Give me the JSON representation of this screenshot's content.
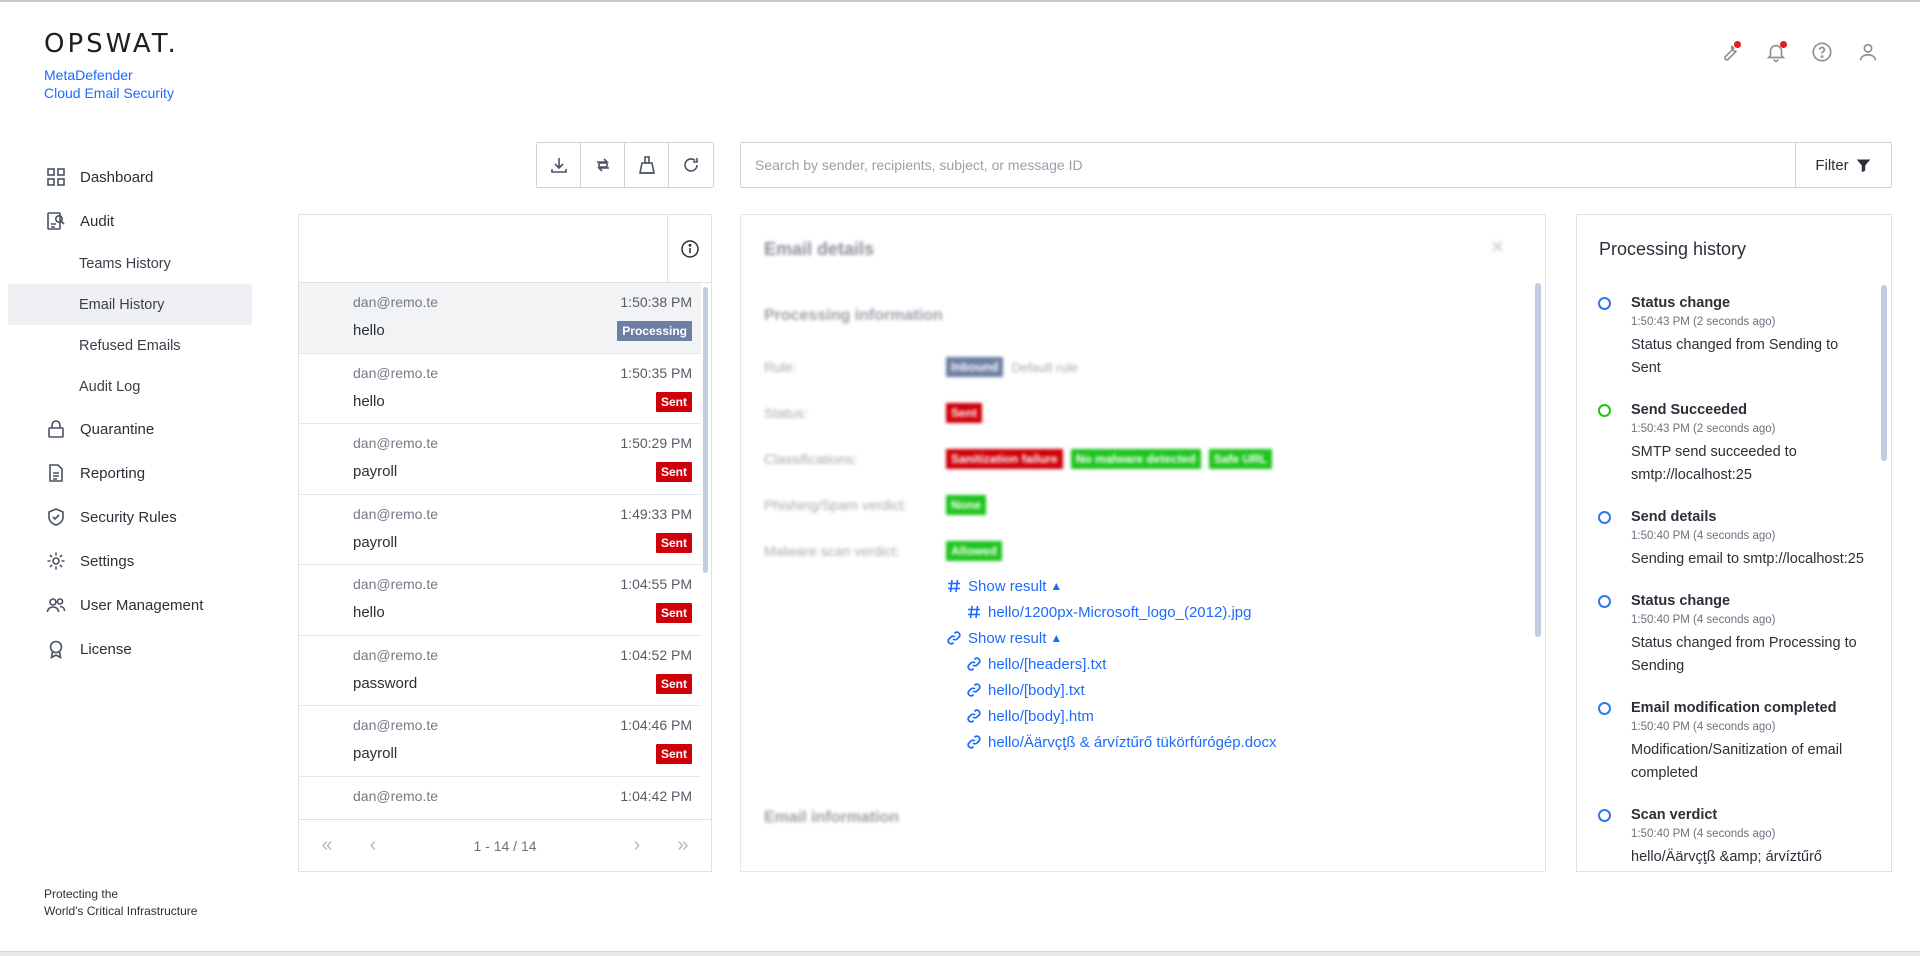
{
  "brand": {
    "logo": "OPSWAT.",
    "product_line1": "MetaDefender",
    "product_line2": "Cloud Email Security"
  },
  "footer": {
    "line1": "Protecting the",
    "line2": "World's Critical Infrastructure"
  },
  "nav": {
    "dashboard": "Dashboard",
    "audit": "Audit",
    "teams_history": "Teams History",
    "email_history": "Email History",
    "refused_emails": "Refused Emails",
    "audit_log": "Audit Log",
    "quarantine": "Quarantine",
    "reporting": "Reporting",
    "security_rules": "Security Rules",
    "settings": "Settings",
    "user_management": "User Management",
    "license": "License"
  },
  "search": {
    "placeholder": "Search by sender, recipients, subject, or message ID",
    "filter_label": "Filter"
  },
  "email_list": {
    "rows": [
      {
        "sender": "dan@remo.te",
        "time": "1:50:38 PM",
        "subject": "hello",
        "status": "Processing"
      },
      {
        "sender": "dan@remo.te",
        "time": "1:50:35 PM",
        "subject": "hello",
        "status": "Sent"
      },
      {
        "sender": "dan@remo.te",
        "time": "1:50:29 PM",
        "subject": "payroll",
        "status": "Sent"
      },
      {
        "sender": "dan@remo.te",
        "time": "1:49:33 PM",
        "subject": "payroll",
        "status": "Sent"
      },
      {
        "sender": "dan@remo.te",
        "time": "1:04:55 PM",
        "subject": "hello",
        "status": "Sent"
      },
      {
        "sender": "dan@remo.te",
        "time": "1:04:52 PM",
        "subject": "password",
        "status": "Sent"
      },
      {
        "sender": "dan@remo.te",
        "time": "1:04:46 PM",
        "subject": "payroll",
        "status": "Sent"
      },
      {
        "sender": "dan@remo.te",
        "time": "1:04:42 PM",
        "subject": "",
        "status": ""
      }
    ],
    "pagination": "1 - 14 / 14"
  },
  "details": {
    "title": "Email details",
    "section_processing": "Processing information",
    "rule_label": "Rule:",
    "rule_chip": "Inbound",
    "rule_name": "Default rule",
    "status_label": "Status:",
    "status_chip": "Sent",
    "classifications_label": "Classifications:",
    "classifications": [
      "Sanitization failure",
      "No malware detected",
      "Safe URL"
    ],
    "phishing_label": "Phishing/Spam verdict:",
    "phishing_chip": "None",
    "malware_label": "Malware scan verdict:",
    "malware_chip": "Allowed",
    "show_result_1": "Show result",
    "result_files_1": [
      "hello/1200px-Microsoft_logo_(2012).jpg"
    ],
    "show_result_2": "Show result",
    "result_files_2": [
      "hello/[headers].txt",
      "hello/[body].txt",
      "hello/[body].htm",
      "hello/Äärvçţß & árvíztűrő tükörfúrógép.docx"
    ],
    "section_email": "Email information"
  },
  "history": {
    "title": "Processing history",
    "items": [
      {
        "head": "Status change",
        "time": "1:50:43 PM (2 seconds ago)",
        "desc": "Status changed from Sending to Sent",
        "color": "#2f79e8"
      },
      {
        "head": "Send Succeeded",
        "time": "1:50:43 PM (2 seconds ago)",
        "desc": "SMTP send succeeded to smtp://localhost:25",
        "color": "#1ec41e"
      },
      {
        "head": "Send details",
        "time": "1:50:40 PM (4 seconds ago)",
        "desc": "Sending email to smtp://localhost:25",
        "color": "#2f79e8"
      },
      {
        "head": "Status change",
        "time": "1:50:40 PM (4 seconds ago)",
        "desc": "Status changed from Processing to Sending",
        "color": "#2f79e8"
      },
      {
        "head": "Email modification completed",
        "time": "1:50:40 PM (4 seconds ago)",
        "desc": "Modification/Sanitization of email completed",
        "color": "#2f79e8"
      },
      {
        "head": "Scan verdict",
        "time": "1:50:40 PM (4 seconds ago)",
        "desc": "hello/Äärvçţß &amp; árvíztűrő",
        "color": "#2f79e8"
      }
    ]
  },
  "colors": {
    "accent": "#1d6bfc",
    "sent": "#d0000a",
    "processing": "#6d7fa3",
    "allowed": "#1ec41e"
  }
}
